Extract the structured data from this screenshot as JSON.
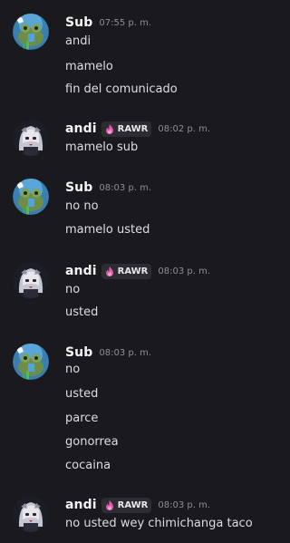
{
  "messages": [
    {
      "author": "Sub",
      "time": "07:55 p. m.",
      "lines": [
        "andi",
        "mamelo",
        "fin del comunicado"
      ]
    },
    {
      "author": "andi",
      "tag": "RAWR",
      "time": "08:02 p. m.",
      "lines": [
        "mamelo sub"
      ]
    },
    {
      "author": "Sub",
      "time": "08:03 p. m.",
      "lines": [
        "no no",
        "mamelo usted"
      ]
    },
    {
      "author": "andi",
      "tag": "RAWR",
      "time": "08:03 p. m.",
      "lines": [
        "no",
        "usted"
      ]
    },
    {
      "author": "Sub",
      "time": "08:03 p. m.",
      "lines": [
        "no",
        "usted",
        "parce",
        "gonorrea",
        "cocaina"
      ]
    },
    {
      "author": "andi",
      "tag": "RAWR",
      "time": "08:03 p. m.",
      "lines": [
        "no usted wey chimichanga taco"
      ]
    }
  ],
  "colors": {
    "background": "#1a1a1e",
    "username": "#f2f3f5",
    "message_text": "#dbdee1",
    "timestamp": "#8a8e96",
    "tag_background": "#2b2d31",
    "tag_icon": "#e05aa8"
  },
  "icons": {
    "sub_avatar": "frog-avatar",
    "andi_avatar": "anime-girl-avatar",
    "tag": "flame-icon"
  }
}
